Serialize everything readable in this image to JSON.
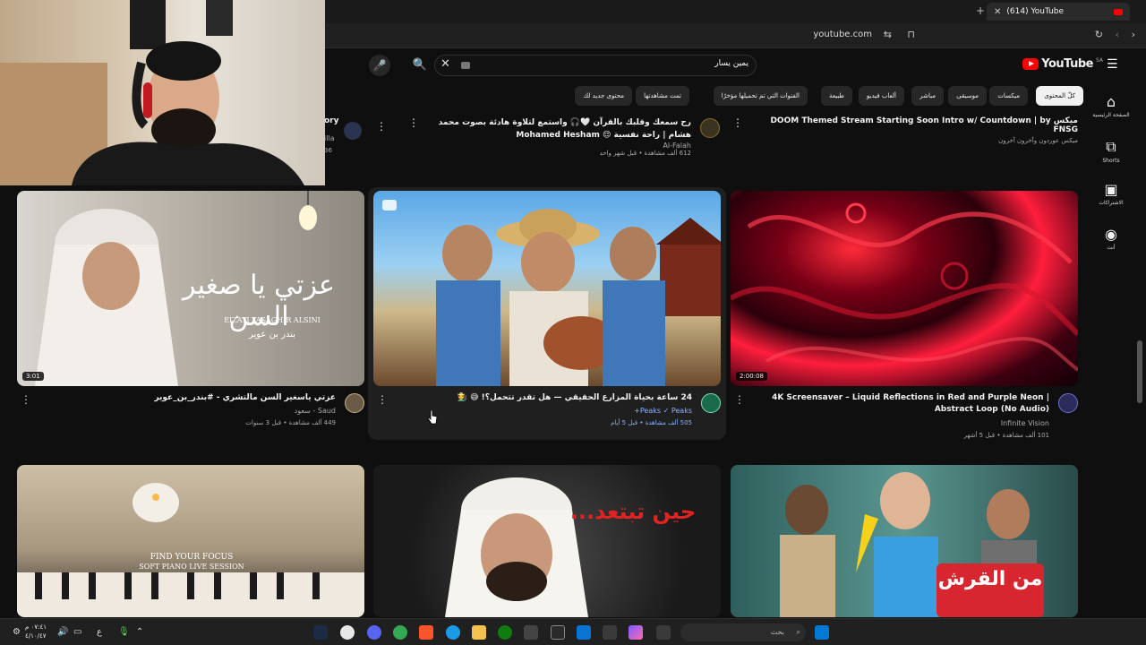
{
  "browser": {
    "tab_title": "(614) YouTube",
    "url": "youtube.com"
  },
  "masthead": {
    "logo": "YouTube",
    "region": "SA",
    "search_query": "يمين يسار"
  },
  "leftnav": [
    {
      "label": "الصفحة الرئيسية",
      "icon": "home-icon"
    },
    {
      "label": "Shorts",
      "icon": "shorts-icon"
    },
    {
      "label": "الاشتراكات",
      "icon": "subscriptions-icon"
    },
    {
      "label": "أنت",
      "icon": "you-icon"
    }
  ],
  "chips": [
    {
      "label": "كلّ المحتوى",
      "active": true
    },
    {
      "label": "ميكسات"
    },
    {
      "label": "موسيقى"
    },
    {
      "label": "مباشر"
    },
    {
      "label": "ألعاب فيديو"
    },
    {
      "label": "طبيعة"
    },
    {
      "label": "الفنوات التي تم تحميلها مؤخرًا"
    },
    {
      "label": "تمت مشاهدتها"
    },
    {
      "label": "محتوى جديد لك"
    }
  ],
  "partial_row": [
    {
      "title": "ميكس DOOM Themed Stream Starting Soon Intro w/ Countdown | by FNSG",
      "channel": "ميكس عوردون وآخرون آخرون"
    },
    {
      "title": "رح سمعك وقلبك بالقرآن 🤍🎧 واستمع لتلاوة هادئة بصوت محمد هشام | راحة نفسية 😌 Mohamed Hesham",
      "channel": "Al-Falah",
      "stats": "612 ألف مشاهدة • قبل شهر واحد"
    },
    {
      "title_fragment": "ory",
      "channel_fragment": "illa",
      "stats_fragment": "36"
    }
  ],
  "videos_row1": [
    {
      "title": "4K Screensaver – Liquid Reflections in Red and Purple Neon | Abstract Loop (No Audio)",
      "channel": "Infinite Vision",
      "stats": "101 ألف مشاهدة • قبل 5 أشهر",
      "duration": "2:00:08"
    },
    {
      "title": "24 ساعة بحياة المزارع الحقيقي — هل تقدر تتحمل؟! 😅 🧑‍🌾",
      "channel": "Peaks ✓ Peaks+",
      "stats": "505 ألف مشاهدة • قبل 5 أيام",
      "duration": ""
    },
    {
      "title": "عزتي ياسغير السن مالتشري - #بندر_بن_عوير",
      "channel": "Saud - سعود",
      "stats": "449 ألف مشاهدة • قبل 3 سنوات",
      "duration": "3:01",
      "thumb_title": "عزتي يا صغير السن",
      "thumb_latin": "EIZATI YASAGHIR ALSINI",
      "thumb_artist": "بندر بن عوير"
    }
  ],
  "videos_row2": [
    {
      "thumb_text": "من القرش"
    },
    {
      "thumb_text": "حين تبتعد..."
    },
    {
      "thumb_line1": "FIND YOUR FOCUS",
      "thumb_line2": "SOFT PIANO LIVE SESSION"
    }
  ],
  "taskbar": {
    "search_placeholder": "بحث",
    "time": "٠٧:٤١ م",
    "date": "٤/١٠/٤٧"
  },
  "colors": {
    "background": "#0f0f0f",
    "accent": "#ff0000",
    "chip": "#272727",
    "chip_active": "#f1f1f1"
  }
}
